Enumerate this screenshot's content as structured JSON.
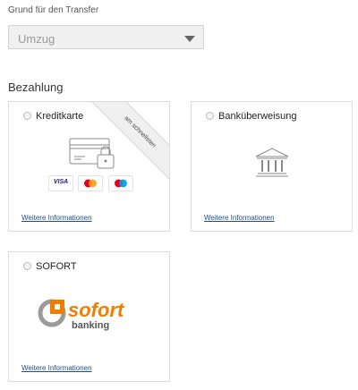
{
  "transfer": {
    "label": "Grund für den Transfer",
    "selected": "Umzug"
  },
  "payment": {
    "title": "Bezahlung",
    "options": [
      {
        "label": "Kreditkarte",
        "badge": "am schnellsten",
        "link": "Weitere Informationen",
        "card_brands": [
          "VISA",
          "Mastercard",
          "Maestro"
        ]
      },
      {
        "label": "Banküberweisung",
        "link": "Weitere Informationen"
      },
      {
        "label": "SOFORT",
        "logo_text": "sofort",
        "logo_subtext": "banking",
        "link": "Weitere Informationen"
      }
    ]
  },
  "colors": {
    "link": "#1f4e8c",
    "sofort_orange": "#ef7d00",
    "sofort_gray": "#9a9a9a",
    "mastercard_red": "#eb001b",
    "mastercard_orange": "#f79e1b",
    "maestro_blue": "#0099df"
  },
  "icons": [
    "chevron-down-icon",
    "credit-card-lock-icon",
    "bank-building-icon",
    "sofort-logo"
  ]
}
